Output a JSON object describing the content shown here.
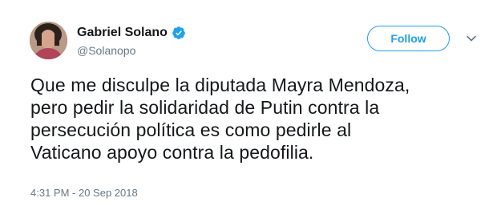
{
  "user": {
    "display_name": "Gabriel Solano",
    "handle": "@Solanopo",
    "verified": true
  },
  "actions": {
    "follow_label": "Follow"
  },
  "tweet": {
    "lines": [
      "Que me disculpe la diputada Mayra Mendoza,",
      "pero pedir la solidaridad de Putin contra la",
      "persecución política es como pedirle al",
      "Vaticano apoyo contra la pedofilia."
    ],
    "timestamp": "4:31 PM - 20 Sep 2018"
  },
  "colors": {
    "accent": "#1da1f2",
    "text": "#14171a",
    "secondary_text": "#657786"
  },
  "icons": {
    "verified": "verified-badge-icon",
    "menu": "chevron-down-icon"
  }
}
